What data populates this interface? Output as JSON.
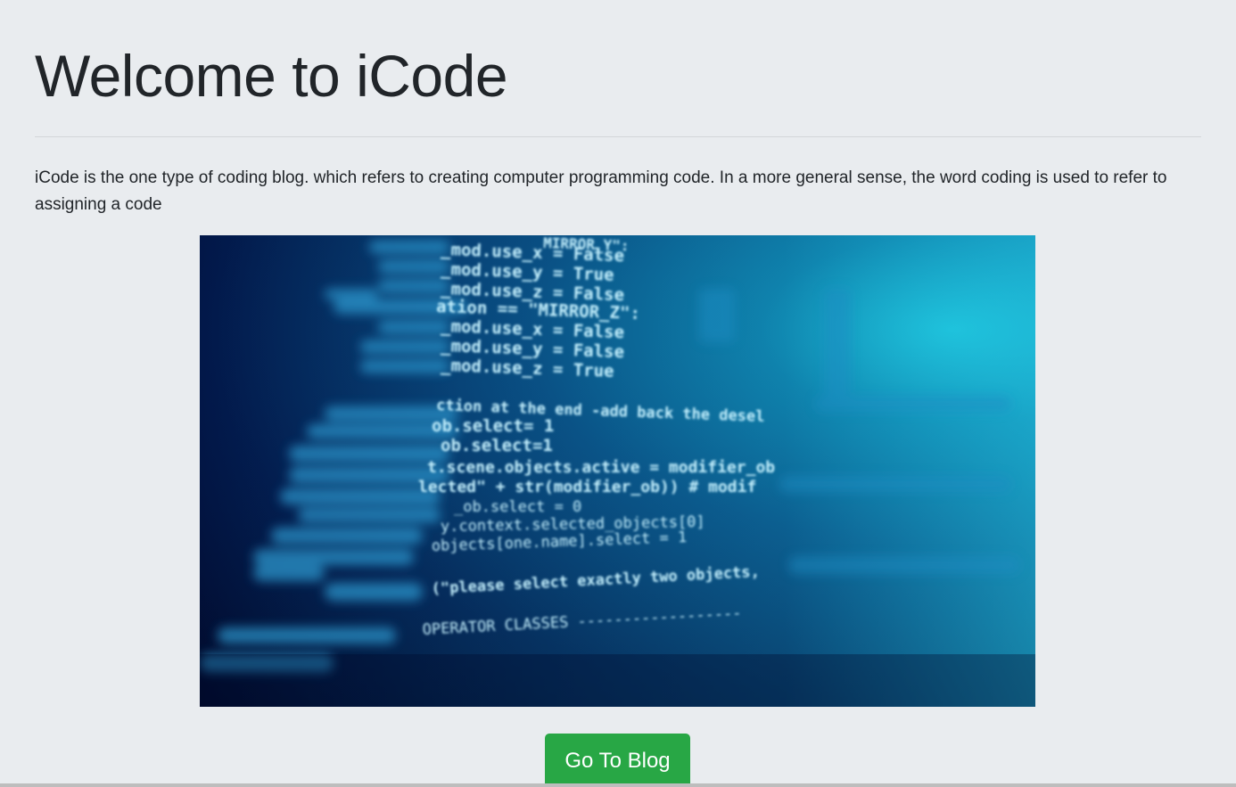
{
  "jumbotron": {
    "title": "Welcome to iCode",
    "description": "iCode is the one type of coding blog. which refers to creating computer programming code. In a more general sense, the word coding is used to refer to assigning a code",
    "button_label": "Go To Blog"
  },
  "image": {
    "alt": "code on screen",
    "code_lines": [
      "MIRROR_Y\":",
      "_mod.use_x = False",
      "_mod.use_y = True",
      "_mod.use_z = False",
      "ation == \"MIRROR_Z\":",
      "_mod.use_x = False",
      "_mod.use_y = False",
      "_mod.use_z = True",
      "ction at the end -add back the desel",
      "ob.select= 1",
      "ob.select=1",
      "t.scene.objects.active = modifier_ob",
      "lected\" + str(modifier_ob)) # modif",
      "_ob.select = 0",
      "y.context.selected_objects[0]",
      "objects[one.name].select = 1",
      "(\"please select exactly two objects,",
      "OPERATOR CLASSES ------------------"
    ]
  },
  "colors": {
    "background": "#e9ecef",
    "button": "#28a745",
    "code_text": "#bfefff"
  }
}
